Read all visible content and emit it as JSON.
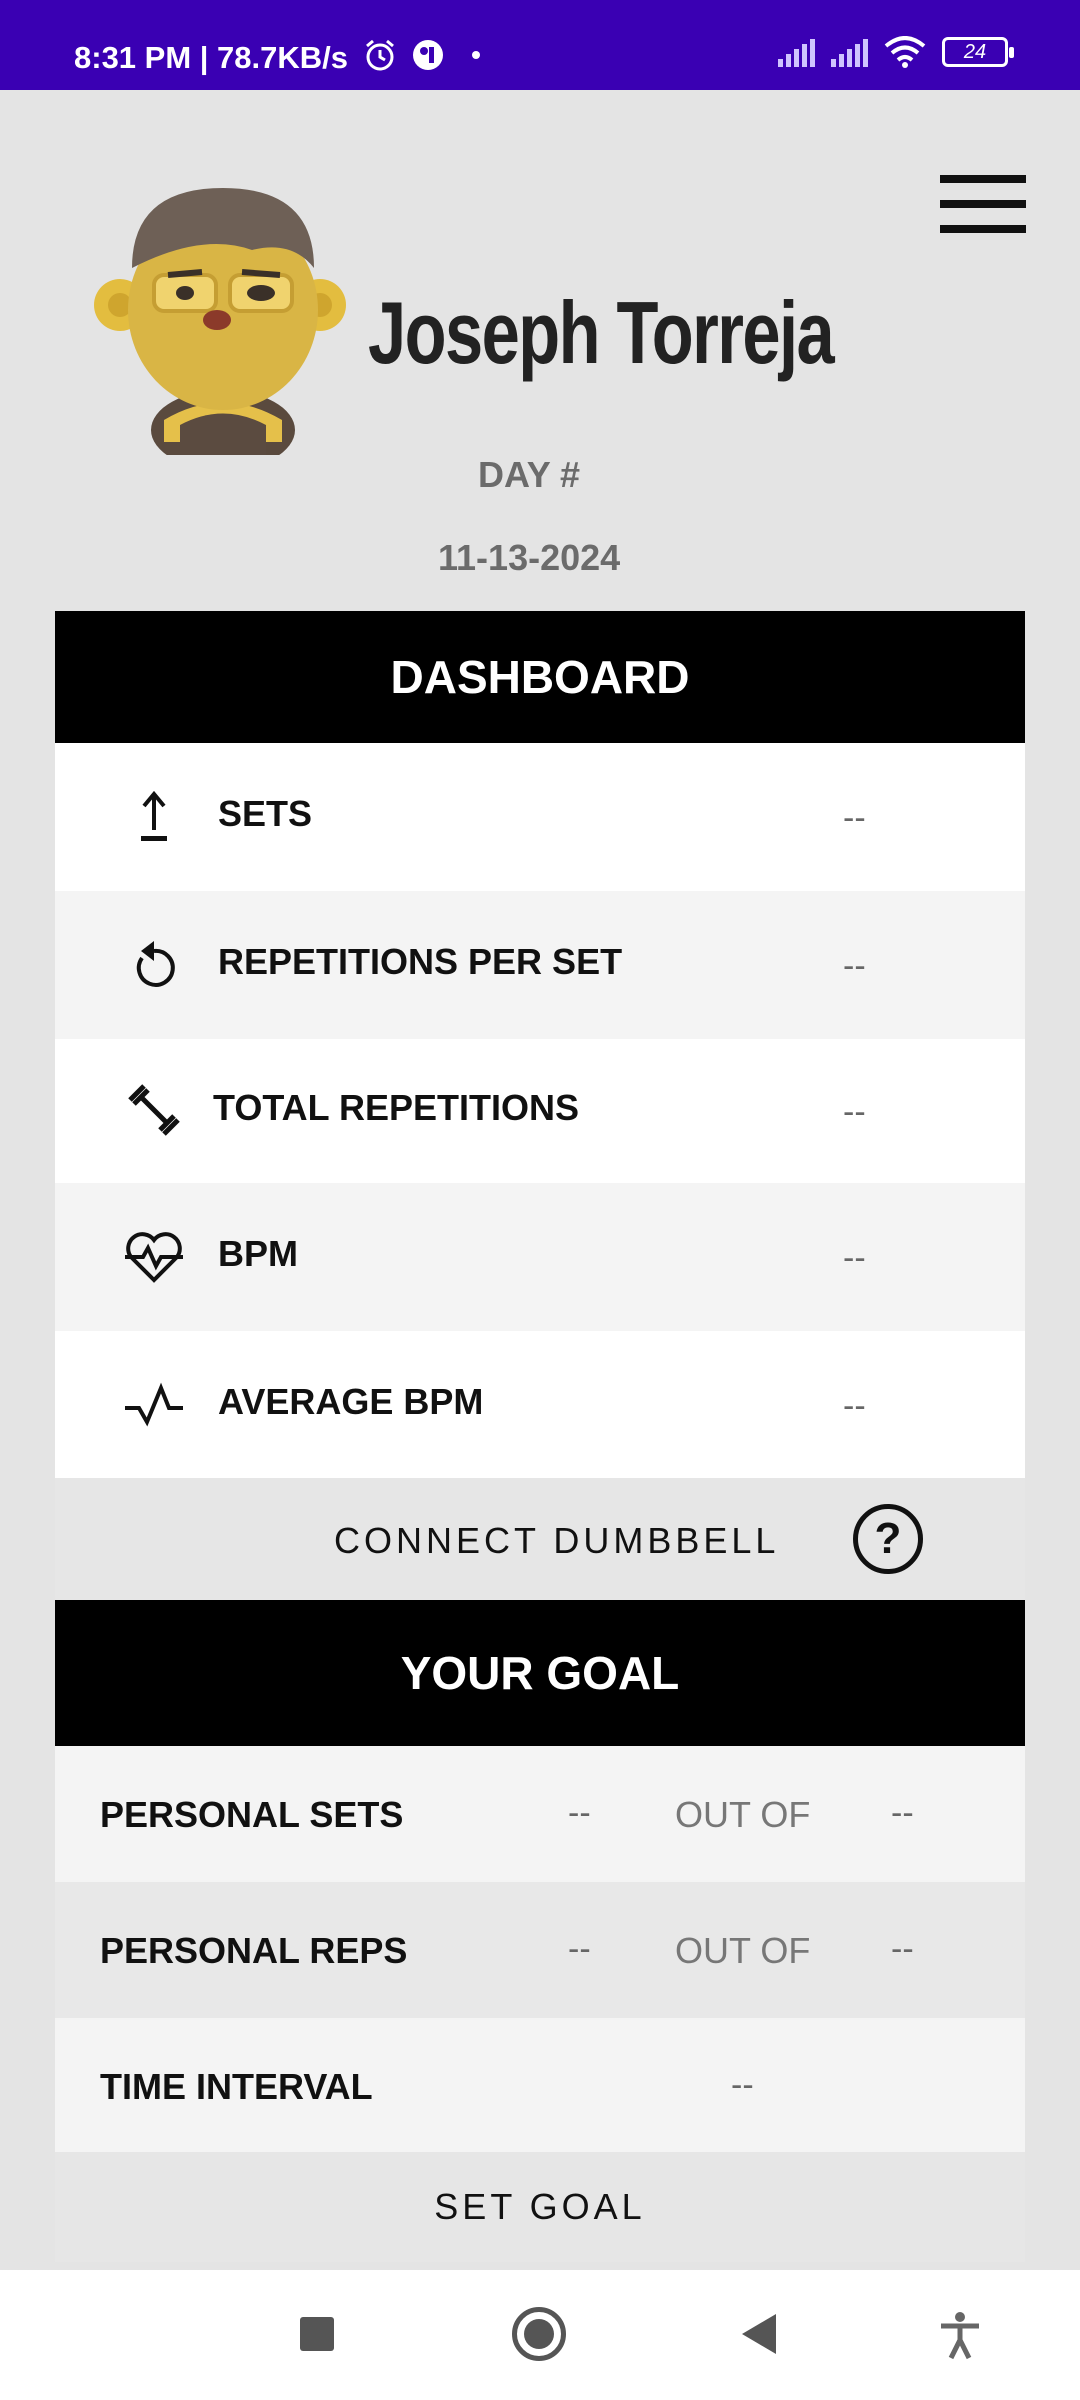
{
  "status_bar": {
    "time_speed": "8:31 PM | 78.7KB/s",
    "battery": "24",
    "icons": [
      "alarm-icon",
      "app-notification-icon",
      "dot-icon",
      "signal-icon",
      "signal-icon",
      "wifi-icon",
      "battery-icon"
    ]
  },
  "header": {
    "user_name": "Joseph Torreja",
    "day_label": "DAY #",
    "date": "11-13-2024",
    "menu_icon": "hamburger-menu-icon"
  },
  "dashboard": {
    "title": "DASHBOARD",
    "rows": [
      {
        "icon": "upload-arrow-icon",
        "label": "SETS",
        "value": "--"
      },
      {
        "icon": "refresh-icon",
        "label": "REPETITIONS PER SET",
        "value": "--"
      },
      {
        "icon": "dumbbell-icon",
        "label": "TOTAL REPETITIONS",
        "value": "--"
      },
      {
        "icon": "heart-pulse-icon",
        "label": "BPM",
        "value": "--"
      },
      {
        "icon": "pulse-line-icon",
        "label": "AVERAGE BPM",
        "value": "--"
      }
    ],
    "connect_label": "CONNECT DUMBBELL",
    "help_symbol": "?"
  },
  "goal": {
    "title": "YOUR GOAL",
    "rows": [
      {
        "label": "PERSONAL SETS",
        "current": "--",
        "out_of": "OUT OF",
        "target": "--"
      },
      {
        "label": "PERSONAL REPS",
        "current": "--",
        "out_of": "OUT OF",
        "target": "--"
      }
    ],
    "time_interval": {
      "label": "TIME INTERVAL",
      "value": "--"
    },
    "set_goal_label": "SET GOAL"
  },
  "nav_bar": {
    "icons": [
      "recent-apps-icon",
      "home-icon",
      "back-icon",
      "accessibility-icon"
    ]
  },
  "colors": {
    "status_bar": "#3a00b3",
    "background": "#e4e4e4",
    "section_header": "#000000"
  }
}
